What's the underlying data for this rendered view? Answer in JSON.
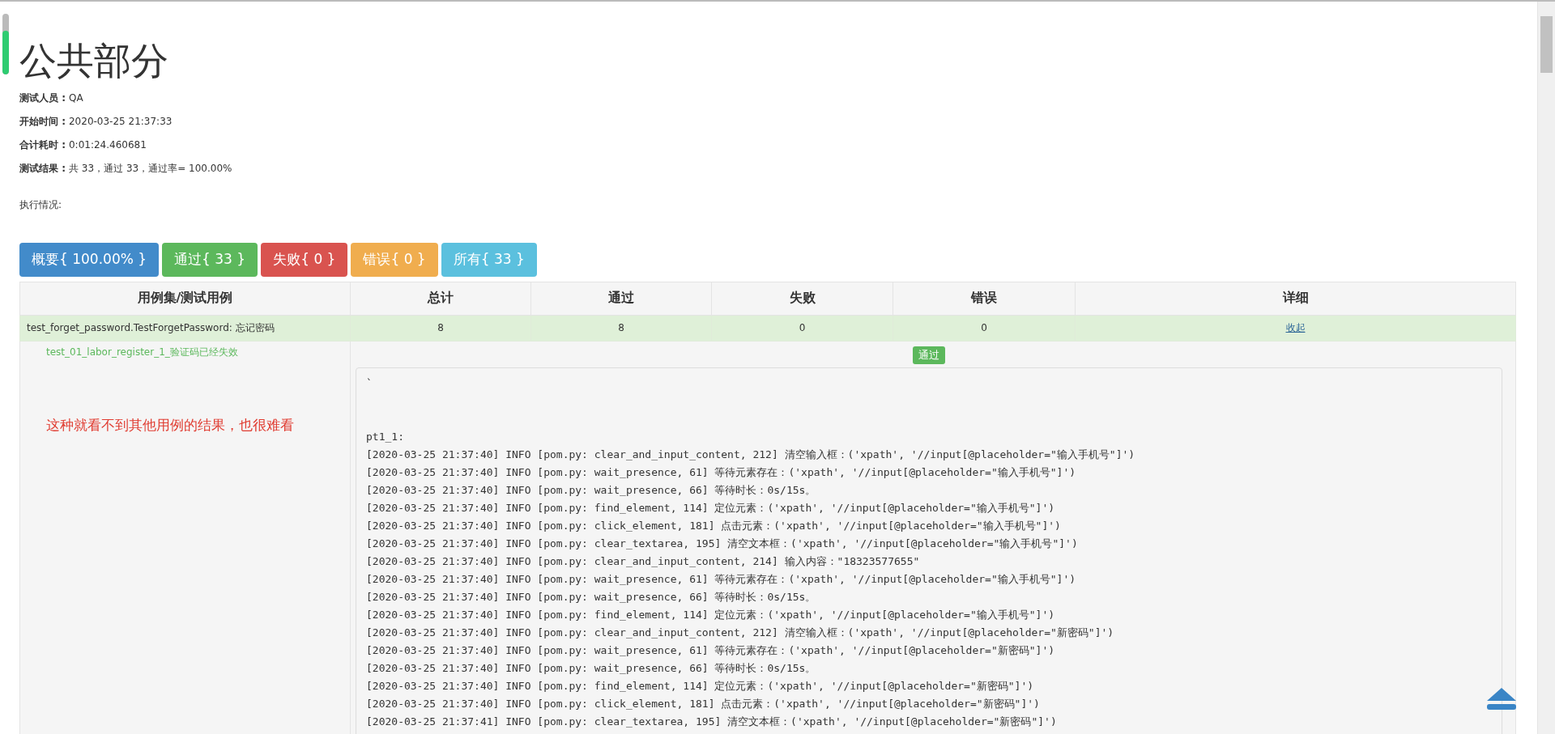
{
  "page_progress": {
    "level": 0.72
  },
  "title": "公共部分",
  "info": [
    {
      "label": "测试人员 :",
      "value": "QA"
    },
    {
      "label": "开始时间 :",
      "value": "2020-03-25 21:37:33"
    },
    {
      "label": "合计耗时 :",
      "value": "0:01:24.460681"
    },
    {
      "label": "测试结果 :",
      "value": "共 33，通过 33，通过率= 100.00%"
    }
  ],
  "execution_label": "执行情况:",
  "filter_buttons": [
    {
      "label": "概要{ 100.00% }",
      "kind": "primary"
    },
    {
      "label": "通过{ 33 }",
      "kind": "success"
    },
    {
      "label": "失败{ 0 }",
      "kind": "danger"
    },
    {
      "label": "错误{ 0 }",
      "kind": "warning"
    },
    {
      "label": "所有{ 33 }",
      "kind": "info"
    }
  ],
  "table": {
    "columns": [
      "用例集/测试用例",
      "总计",
      "通过",
      "失败",
      "错误",
      "详细"
    ],
    "suite": {
      "kind": "pass",
      "name": "test_forget_password.TestForgetPassword: 忘记密码",
      "total": "8",
      "passed": "8",
      "failed": "0",
      "errors": "0",
      "detail_link": "收起"
    },
    "case": {
      "kind": "pass",
      "name": "test_01_labor_register_1_验证码已经失效",
      "annotation": "这种就看不到其他用例的结果，也很难看",
      "result_button": "通过",
      "log_lines": [
        "`",
        "pt1_1:",
        "[2020-03-25 21:37:40] INFO [pom.py: clear_and_input_content, 212] 清空输入框：('xpath', '//input[@placeholder=\"输入手机号\"]')",
        "[2020-03-25 21:37:40] INFO [pom.py: wait_presence, 61] 等待元素存在：('xpath', '//input[@placeholder=\"输入手机号\"]')",
        "[2020-03-25 21:37:40] INFO [pom.py: wait_presence, 66] 等待时长：0s/15s。",
        "[2020-03-25 21:37:40] INFO [pom.py: find_element, 114] 定位元素：('xpath', '//input[@placeholder=\"输入手机号\"]')",
        "[2020-03-25 21:37:40] INFO [pom.py: click_element, 181] 点击元素：('xpath', '//input[@placeholder=\"输入手机号\"]')",
        "[2020-03-25 21:37:40] INFO [pom.py: clear_textarea, 195] 清空文本框：('xpath', '//input[@placeholder=\"输入手机号\"]')",
        "[2020-03-25 21:37:40] INFO [pom.py: clear_and_input_content, 214] 输入内容：\"18323577655\"",
        "[2020-03-25 21:37:40] INFO [pom.py: wait_presence, 61] 等待元素存在：('xpath', '//input[@placeholder=\"输入手机号\"]')",
        "[2020-03-25 21:37:40] INFO [pom.py: wait_presence, 66] 等待时长：0s/15s。",
        "[2020-03-25 21:37:40] INFO [pom.py: find_element, 114] 定位元素：('xpath', '//input[@placeholder=\"输入手机号\"]')",
        "[2020-03-25 21:37:40] INFO [pom.py: clear_and_input_content, 212] 清空输入框：('xpath', '//input[@placeholder=\"新密码\"]')",
        "[2020-03-25 21:37:40] INFO [pom.py: wait_presence, 61] 等待元素存在：('xpath', '//input[@placeholder=\"新密码\"]')",
        "[2020-03-25 21:37:40] INFO [pom.py: wait_presence, 66] 等待时长：0s/15s。",
        "[2020-03-25 21:37:40] INFO [pom.py: find_element, 114] 定位元素：('xpath', '//input[@placeholder=\"新密码\"]')",
        "[2020-03-25 21:37:40] INFO [pom.py: click_element, 181] 点击元素：('xpath', '//input[@placeholder=\"新密码\"]')",
        "[2020-03-25 21:37:41] INFO [pom.py: clear_textarea, 195] 清空文本框：('xpath', '//input[@placeholder=\"新密码\"]')"
      ]
    }
  }
}
